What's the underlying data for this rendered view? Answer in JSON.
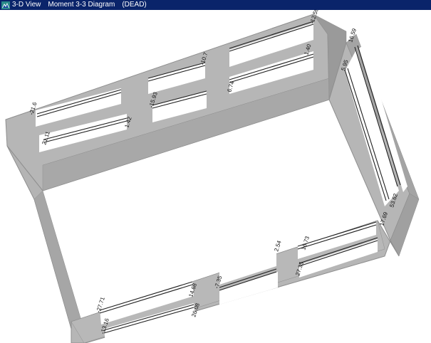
{
  "window": {
    "title_segments": [
      "3-D View",
      "Moment 3-3 Diagram",
      "(DEAD)"
    ]
  },
  "colors": {
    "title_bar": "#0a246a",
    "wall_face": "#b6b6b6",
    "wall_edge": "#8e8e8e",
    "wall_side": "#9a9a9a",
    "member": "#202020"
  },
  "labels": {
    "back_1": "-21.6",
    "back_2": "21.11",
    "back_3": "1.42",
    "back_4": "-10.7",
    "back_5": "-15.93",
    "back_6": "6.74",
    "back_7": "-12.59",
    "back_8": "1.40",
    "right_1": "16.59",
    "right_2": "5.95",
    "right_3": "53.62",
    "right_4": "17.69",
    "front_1": "-27.71",
    "front_2": "-13.16",
    "front_3": "14.68",
    "front_4": "26.08",
    "front_5": "-7.35",
    "front_6": "2.54",
    "front_7": "16.73",
    "front_8": "27.35"
  }
}
